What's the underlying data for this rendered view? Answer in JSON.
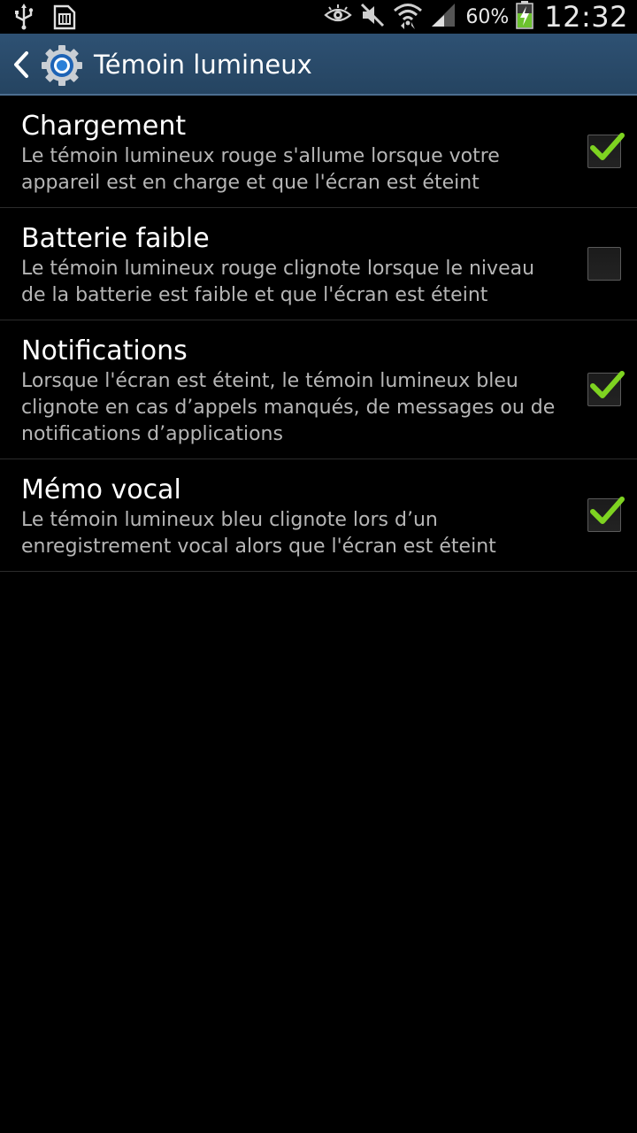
{
  "status_bar": {
    "left_icons": [
      "usb-icon",
      "sim-card-icon"
    ],
    "right_icons": [
      "eye-smart-stay-icon",
      "mute-icon",
      "wifi-icon",
      "signal-icon",
      "battery-charging-icon"
    ],
    "battery_percent": "60%",
    "time": "12:32"
  },
  "action_bar": {
    "title": "Témoin lumineux",
    "icon": "settings-gear-icon",
    "background_color": "#2b4c6c"
  },
  "items": [
    {
      "title": "Chargement",
      "description": "Le témoin lumineux rouge s'allume lorsque votre appareil est en charge et que l'écran est éteint",
      "checked": true
    },
    {
      "title": "Batterie faible",
      "description": "Le témoin lumineux rouge clignote lorsque le niveau de la batterie est faible et que l'écran est éteint",
      "checked": false
    },
    {
      "title": "Notifications",
      "description": "Lorsque l'écran est éteint, le témoin lumineux bleu clignote en cas d’appels manqués, de messages ou de notifications d’applications",
      "checked": true
    },
    {
      "title": "Mémo vocal",
      "description": "Le témoin lumineux bleu clignote lors d’un enregistrement vocal alors que l'écran est éteint",
      "checked": true
    }
  ],
  "colors": {
    "check_green": "#7ed321",
    "divider": "#2b2b2b",
    "description_text": "#b6b6b6"
  }
}
